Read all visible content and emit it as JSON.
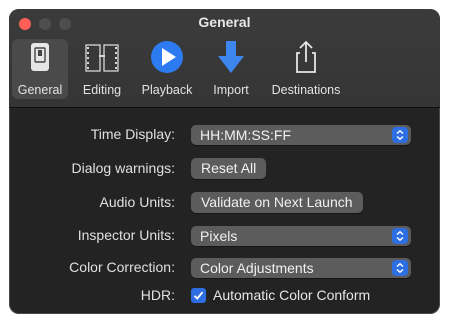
{
  "window": {
    "title": "General"
  },
  "toolbar": {
    "items": [
      {
        "label": "General",
        "icon": "general-switch-icon",
        "selected": true
      },
      {
        "label": "Editing",
        "icon": "film-strip-icon",
        "selected": false
      },
      {
        "label": "Playback",
        "icon": "play-icon",
        "selected": false
      },
      {
        "label": "Import",
        "icon": "import-arrow-icon",
        "selected": false
      },
      {
        "label": "Destinations",
        "icon": "share-icon",
        "selected": false
      }
    ]
  },
  "settings": {
    "time_display": {
      "label": "Time Display:",
      "value": "HH:MM:SS:FF"
    },
    "dialog_warnings": {
      "label": "Dialog warnings:",
      "button": "Reset All"
    },
    "audio_units": {
      "label": "Audio Units:",
      "button": "Validate on Next Launch"
    },
    "inspector_units": {
      "label": "Inspector Units:",
      "value": "Pixels"
    },
    "color_correction": {
      "label": "Color Correction:",
      "value": "Color Adjustments"
    },
    "hdr": {
      "label": "HDR:",
      "checkbox_label": "Automatic Color Conform",
      "checked": true
    }
  },
  "colors": {
    "accent": "#2d6fe3",
    "window_bg": "#232323",
    "close": "#ff5f57"
  }
}
